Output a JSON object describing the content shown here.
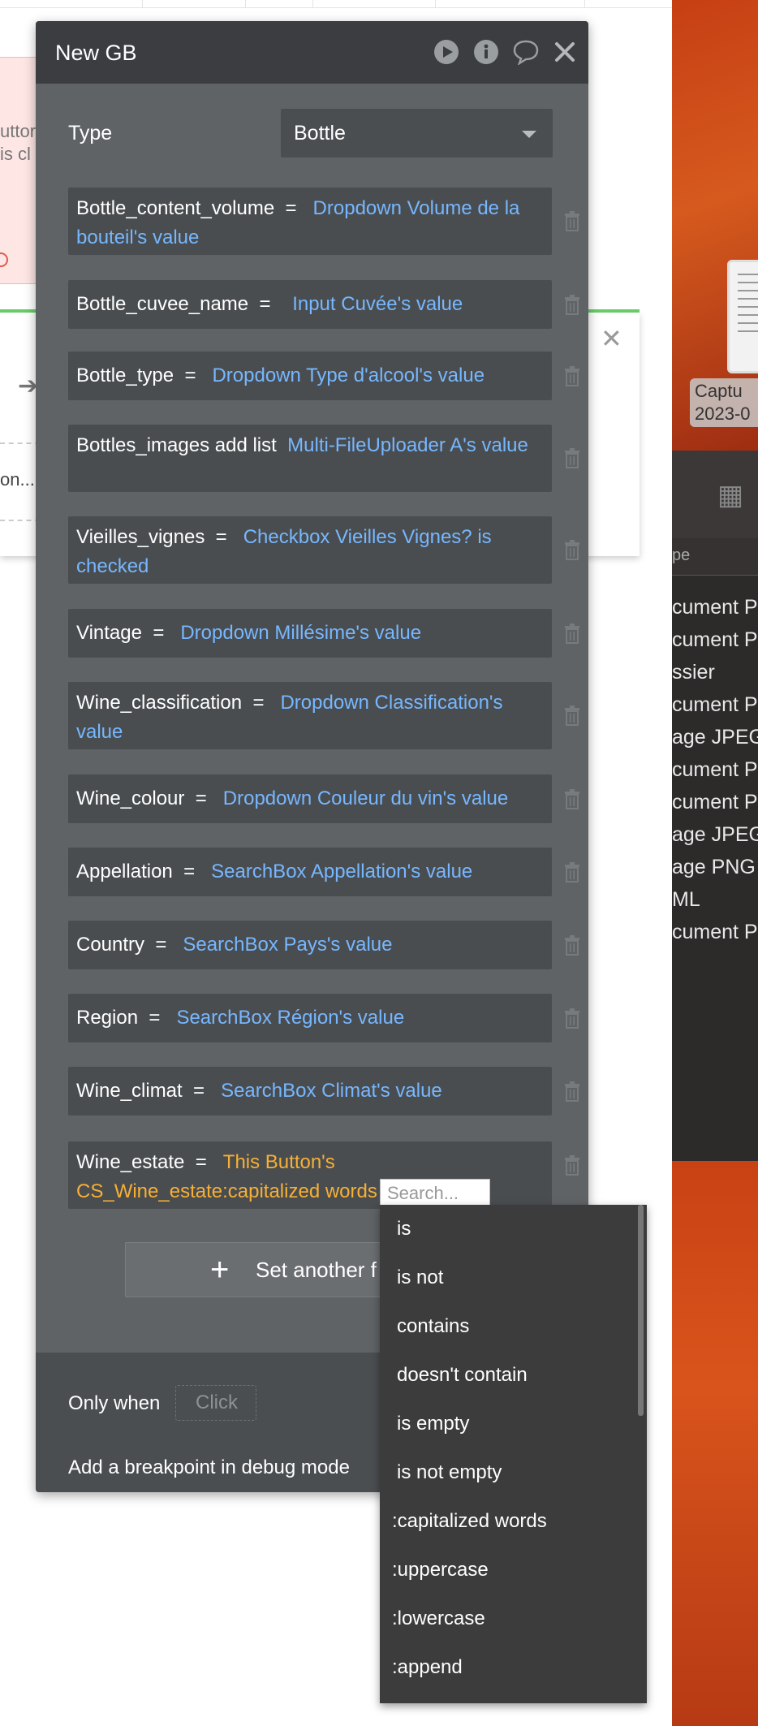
{
  "background": {
    "redbox_lines": [
      "uttor",
      "is cl"
    ],
    "panel_text": "on..."
  },
  "desktop": {
    "capture_lines": [
      "Captu",
      "2023-0"
    ],
    "list_header": "pe",
    "files": [
      "cument P",
      "cument P",
      "ssier",
      "cument P",
      "age JPEG",
      "cument P",
      "cument P",
      "age JPEG",
      "age PNG",
      "ML",
      "cument P"
    ]
  },
  "dialog": {
    "title": "New GB",
    "icons": [
      "play-icon",
      "info-icon",
      "comment-icon",
      "close-icon"
    ],
    "type_label": "Type",
    "type_value": "Bottle",
    "fields": [
      {
        "key": "Bottle_content_volume",
        "op": "=",
        "value": "Dropdown Volume de la bouteil's value"
      },
      {
        "key": "Bottle_cuvee_name",
        "op": "=",
        "value": "Input Cuvée's value"
      },
      {
        "key": "Bottle_type",
        "op": "=",
        "value": "Dropdown Type d'alcool's value"
      },
      {
        "key": "Bottles_images add list",
        "op": "",
        "value": "Multi-FileUploader A's value"
      },
      {
        "key": "Vieilles_vignes",
        "op": "=",
        "value": "Checkbox Vieilles Vignes? is checked"
      },
      {
        "key": "Vintage",
        "op": "=",
        "value": "Dropdown Millésime's value"
      },
      {
        "key": "Wine_classification",
        "op": "=",
        "value": "Dropdown Classification's value"
      },
      {
        "key": "Wine_colour",
        "op": "=",
        "value": "Dropdown Couleur du vin's value"
      },
      {
        "key": "Appellation",
        "op": "=",
        "value": "SearchBox Appellation's value"
      },
      {
        "key": "Country",
        "op": "=",
        "value": "SearchBox Pays's value"
      },
      {
        "key": "Region",
        "op": "=",
        "value": "SearchBox Région's value"
      },
      {
        "key": "Wine_climat",
        "op": "=",
        "value": "SearchBox Climat's value"
      },
      {
        "key": "Wine_estate",
        "op": "=",
        "value": "This Button's CS_Wine_estate:capitalized words"
      }
    ],
    "set_another_label": "Set another f",
    "only_when_label": "Only when",
    "only_when_placeholder": "Click",
    "breakpoint_label": "Add a breakpoint in debug mode"
  },
  "dropdown": {
    "search_placeholder": "Search...",
    "items": [
      "is",
      "is not",
      "contains",
      "doesn't contain",
      "is empty",
      "is not empty",
      ":capitalized words",
      ":uppercase",
      ":lowercase",
      ":append"
    ]
  },
  "colors": {
    "dialog_bg": "#5f6366",
    "header_bg": "#3b3d40",
    "value_blue": "#76b7ff",
    "value_orange": "#f7b035",
    "menu_bg": "#3c3c3c"
  }
}
